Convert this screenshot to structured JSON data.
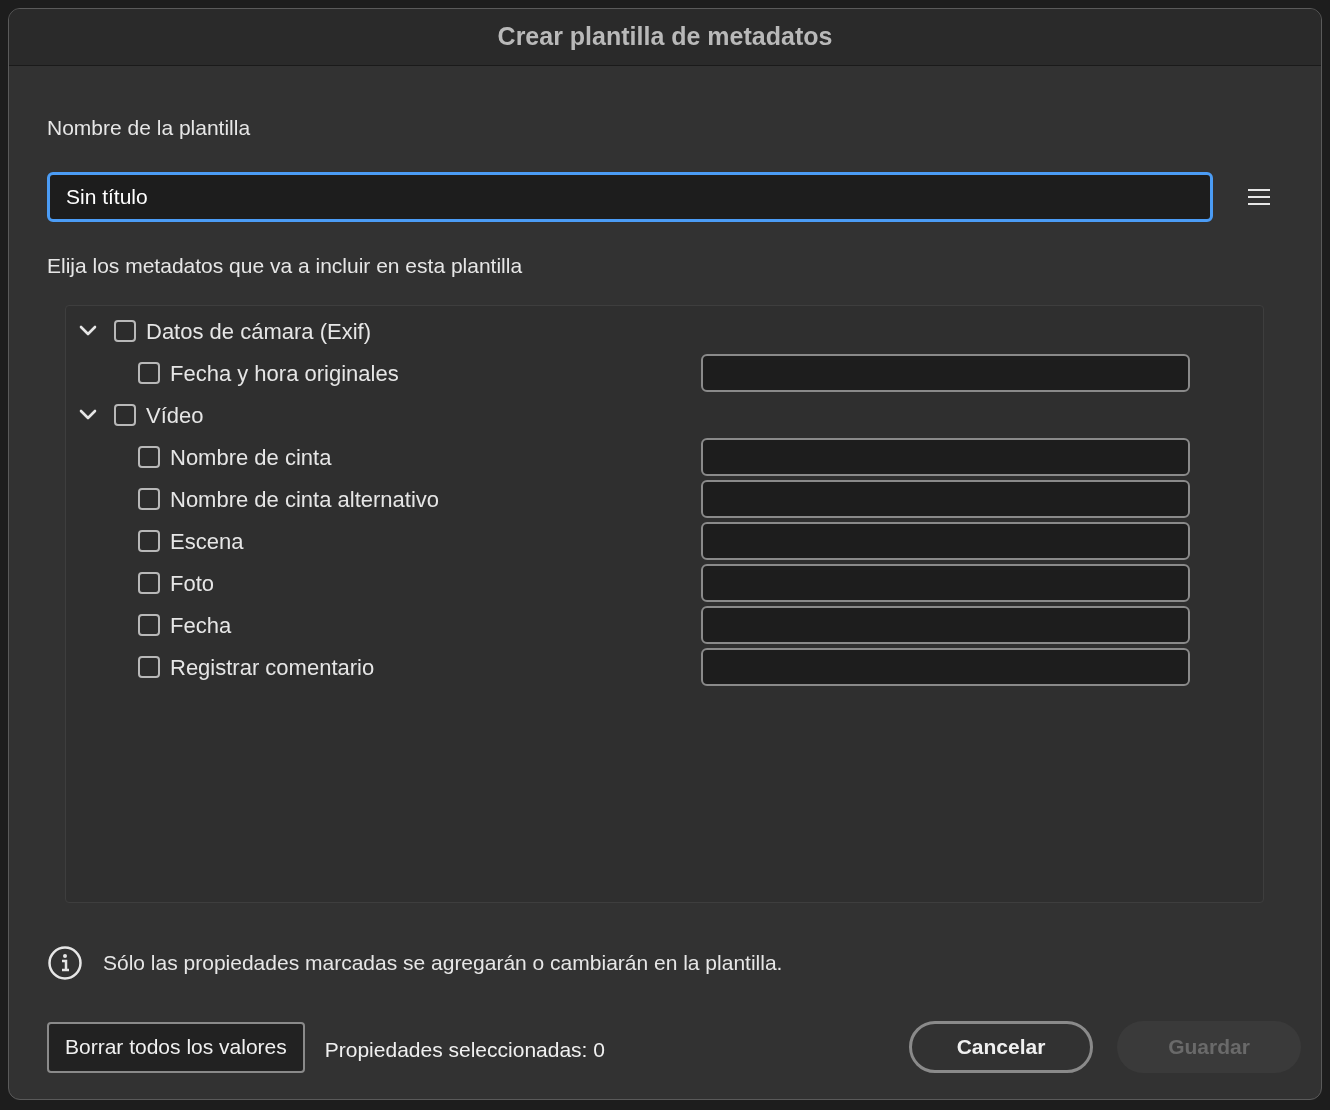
{
  "window": {
    "title": "Crear plantilla de metadatos"
  },
  "template_name": {
    "label": "Nombre de la plantilla",
    "value": "Sin título",
    "focused": true
  },
  "instruction": "Elija los metadatos que va a incluir en esta plantilla",
  "tree": [
    {
      "label": "Datos de cámara (Exif)",
      "expanded": true,
      "checked": false,
      "children": [
        {
          "label": "Fecha y hora originales",
          "checked": false
        }
      ]
    },
    {
      "label": "Vídeo",
      "expanded": true,
      "checked": false,
      "children": [
        {
          "label": "Nombre de cinta",
          "checked": false
        },
        {
          "label": "Nombre de cinta alternativo",
          "checked": false
        },
        {
          "label": "Escena",
          "checked": false
        },
        {
          "label": "Foto",
          "checked": false
        },
        {
          "label": "Fecha",
          "checked": false
        },
        {
          "label": "Registrar comentario",
          "checked": false
        }
      ]
    }
  ],
  "note": "Sólo las propiedades marcadas se agregarán o cambiarán en la plantilla.",
  "footer": {
    "clear_button": "Borrar todos los valores",
    "selected_count": "Propiedades seleccionadas: 0",
    "cancel_button": {
      "label": "Cancelar",
      "disabled": false
    },
    "save_button": {
      "label": "Guardar",
      "disabled": true
    }
  }
}
